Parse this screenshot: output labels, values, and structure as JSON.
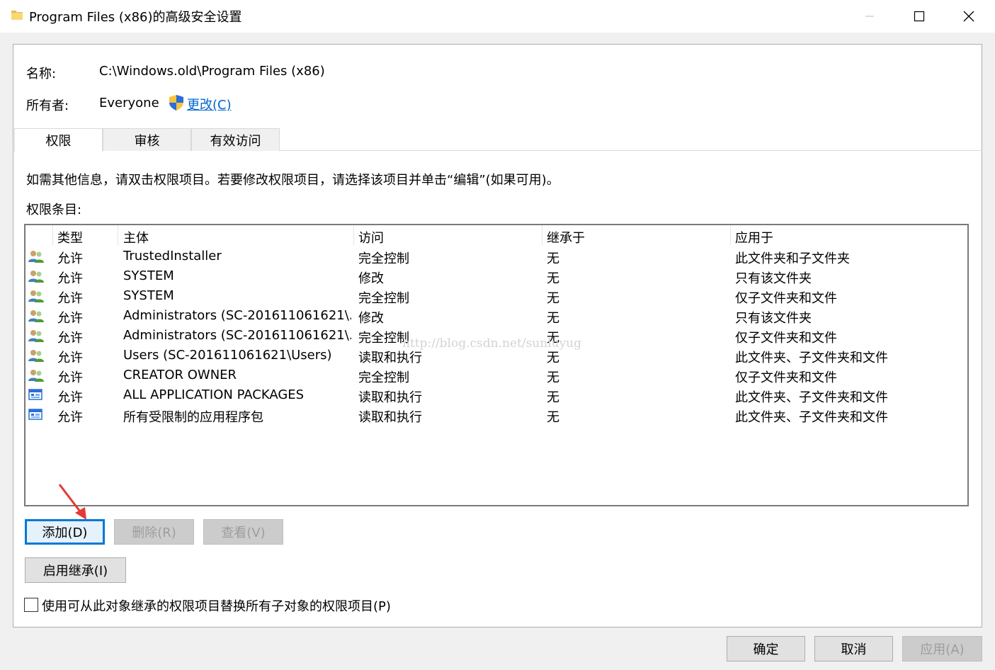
{
  "window": {
    "title": "Program Files (x86)的高级安全设置"
  },
  "info": {
    "name_label": "名称:",
    "name_value": "C:\\Windows.old\\Program Files (x86)",
    "owner_label": "所有者:",
    "owner_value": "Everyone",
    "change_link": "更改(C)"
  },
  "tabs": [
    {
      "label": "权限",
      "active": true
    },
    {
      "label": "审核",
      "active": false
    },
    {
      "label": "有效访问",
      "active": false
    }
  ],
  "instructions": "如需其他信息，请双击权限项目。若要修改权限项目，请选择该项目并单击“编辑”(如果可用)。",
  "entries_label": "权限条目:",
  "table": {
    "columns": [
      "类型",
      "主体",
      "访问",
      "继承于",
      "应用于"
    ],
    "rows": [
      {
        "icon": "users-icon",
        "type": "允许",
        "principal": "TrustedInstaller",
        "access": "完全控制",
        "inherited": "无",
        "applies": "此文件夹和子文件夹"
      },
      {
        "icon": "users-icon",
        "type": "允许",
        "principal": "SYSTEM",
        "access": "修改",
        "inherited": "无",
        "applies": "只有该文件夹"
      },
      {
        "icon": "users-icon",
        "type": "允许",
        "principal": "SYSTEM",
        "access": "完全控制",
        "inherited": "无",
        "applies": "仅子文件夹和文件"
      },
      {
        "icon": "users-icon",
        "type": "允许",
        "principal": "Administrators (SC-201611061621\\...",
        "access": "修改",
        "inherited": "无",
        "applies": "只有该文件夹"
      },
      {
        "icon": "users-icon",
        "type": "允许",
        "principal": "Administrators (SC-201611061621\\...",
        "access": "完全控制",
        "inherited": "无",
        "applies": "仅子文件夹和文件"
      },
      {
        "icon": "users-icon",
        "type": "允许",
        "principal": "Users (SC-201611061621\\Users)",
        "access": "读取和执行",
        "inherited": "无",
        "applies": "此文件夹、子文件夹和文件"
      },
      {
        "icon": "users-icon",
        "type": "允许",
        "principal": "CREATOR OWNER",
        "access": "完全控制",
        "inherited": "无",
        "applies": "仅子文件夹和文件"
      },
      {
        "icon": "app-package-icon",
        "type": "允许",
        "principal": "ALL APPLICATION PACKAGES",
        "access": "读取和执行",
        "inherited": "无",
        "applies": "此文件夹、子文件夹和文件"
      },
      {
        "icon": "app-package-icon",
        "type": "允许",
        "principal": "所有受限制的应用程序包",
        "access": "读取和执行",
        "inherited": "无",
        "applies": "此文件夹、子文件夹和文件"
      }
    ]
  },
  "watermark": "http://blog.csdn.net/sunluyug",
  "buttons": {
    "add": "添加(D)",
    "remove": "删除(R)",
    "view": "查看(V)",
    "enable_inheritance": "启用继承(I)",
    "ok": "确定",
    "cancel": "取消",
    "apply": "应用(A)"
  },
  "replace_checkbox": {
    "label": "使用可从此对象继承的权限项目替换所有子对象的权限项目(P)",
    "checked": false
  },
  "colors": {
    "accent": "#0078d7",
    "link": "#0066cc",
    "annotation_arrow": "#e53935"
  }
}
